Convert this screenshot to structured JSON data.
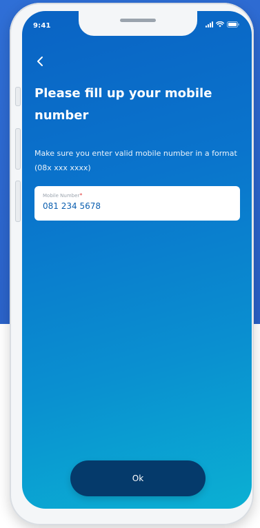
{
  "status_bar": {
    "time": "9:41",
    "icons": [
      "signal-icon",
      "wifi-icon",
      "battery-icon"
    ]
  },
  "header": {
    "back_icon": "chevron-left-icon",
    "title": "Please fill up your mobile number",
    "subtitle": "Make sure you enter valid mobile number in a format (08x xxx xxxx)"
  },
  "form": {
    "mobile_label": "Mobile Number",
    "required_mark": "*",
    "mobile_value": "081 234 5678"
  },
  "actions": {
    "ok_label": "Ok"
  },
  "colors": {
    "screen_gradient_start": "#0a63c4",
    "screen_gradient_end": "#0bb0d3",
    "button_bg": "#053a6b",
    "input_text": "#0b5fb0",
    "required": "#e23b3b"
  }
}
